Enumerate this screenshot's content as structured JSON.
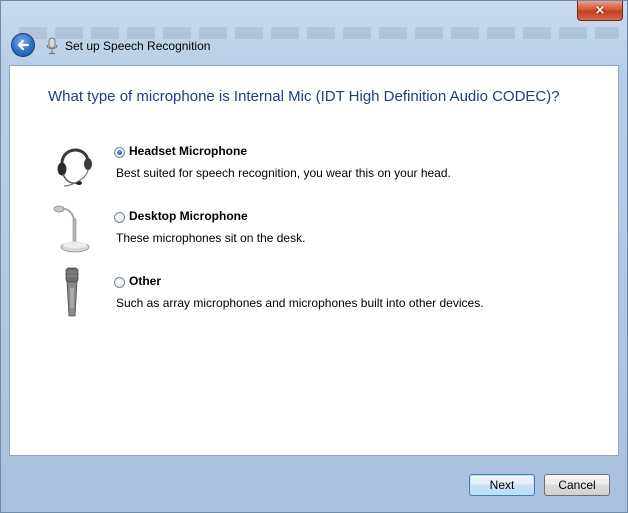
{
  "window": {
    "title": "Set up Speech Recognition",
    "close_label": "×"
  },
  "page": {
    "heading": "What type of microphone is Internal Mic (IDT High Definition Audio CODEC)?"
  },
  "options": [
    {
      "label": "Headset Microphone",
      "description": "Best suited for speech recognition, you wear this on your head.",
      "selected": true,
      "icon": "headset-icon"
    },
    {
      "label": "Desktop Microphone",
      "description": "These microphones sit on the desk.",
      "selected": false,
      "icon": "desktop-microphone-icon"
    },
    {
      "label": "Other",
      "description": "Such as array microphones and microphones built into other devices.",
      "selected": false,
      "icon": "handheld-microphone-icon"
    }
  ],
  "buttons": {
    "next_label": "Next",
    "cancel_label": "Cancel"
  },
  "colors": {
    "heading": "#1e3d8a",
    "accent": "#2f6fc6",
    "close": "#c33d22"
  }
}
